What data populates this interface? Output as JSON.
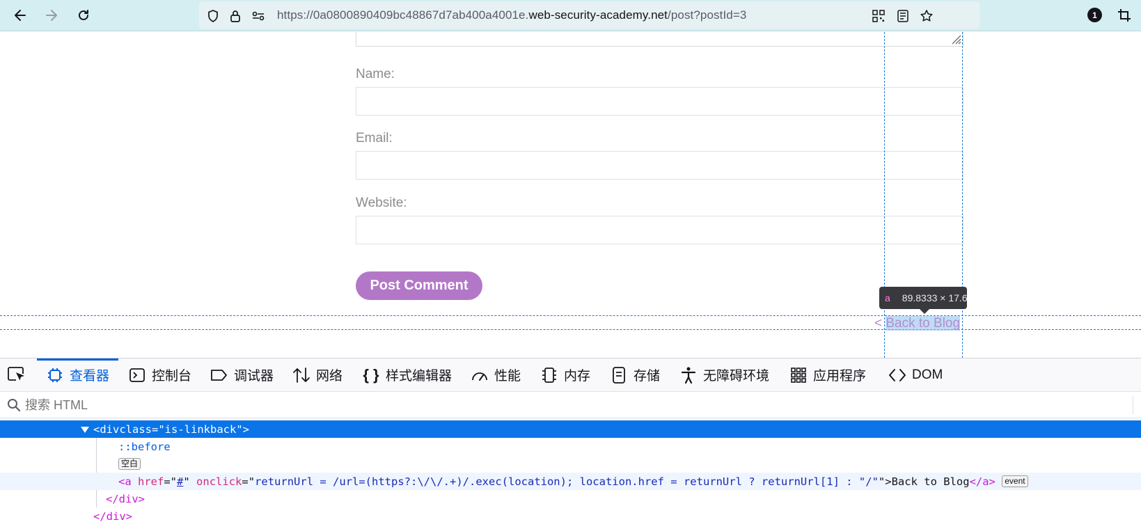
{
  "browser": {
    "url_prefix": "https://0a0800890409bc48867d7ab400a4001e.",
    "url_domain": "web-security-academy.net",
    "url_suffix": "/post?postId=3",
    "extensions_badge": "1"
  },
  "form": {
    "name_label": "Name:",
    "email_label": "Email:",
    "website_label": "Website:",
    "submit_label": "Post Comment"
  },
  "page": {
    "back_prefix": "< ",
    "back_link_text": "Back to Blog"
  },
  "inspector_tooltip": {
    "tag": "a",
    "size": "89.8333 × 17.6"
  },
  "devtools": {
    "tabs": [
      "查看器",
      "控制台",
      "调试器",
      "网络",
      "样式编辑器",
      "性能",
      "内存",
      "存储",
      "无障碍环境",
      "应用程序",
      "DOM"
    ],
    "active_tab": "查看器",
    "search_placeholder": "搜索 HTML",
    "markup": {
      "sel_open": "<div ",
      "sel_attr": "class",
      "sel_eq": "=\"",
      "sel_val": "is-linkback",
      "sel_close": "\">",
      "before": "::before",
      "whitespace_badge": "空白",
      "a_open": "<a",
      "a_href_attr": "href",
      "a_href_val": "#",
      "a_onclick_attr": "onclick",
      "a_onclick_val": "returnUrl = /url=(https?:\\/\\/.+)/.exec(location); location.href = returnUrl ? returnUrl[1] : \"/\"",
      "a_text": "Back to Blog",
      "a_close": "</a>",
      "event_badge": "event",
      "div_close": "</div>",
      "div_close2": "</div>"
    }
  },
  "colors": {
    "toolbar_bg": "#d4eef1",
    "button_bg": "#b377c8",
    "selection": "#0a74e8",
    "guide": "#1a7ad6"
  }
}
